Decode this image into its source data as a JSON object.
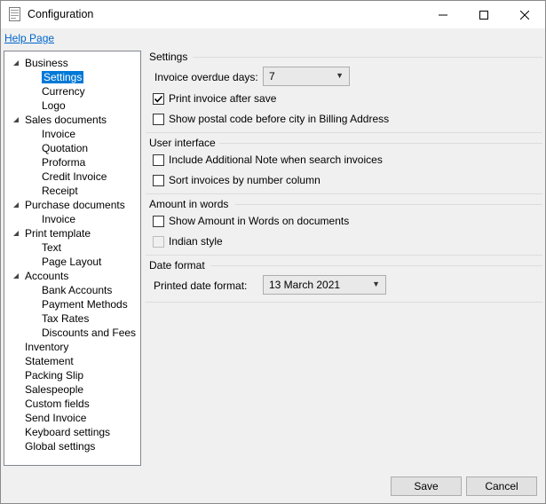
{
  "window": {
    "title": "Configuration"
  },
  "help_link": "Help Page",
  "tree": [
    {
      "label": "Business",
      "level": 0,
      "expanded": true
    },
    {
      "label": "Settings",
      "level": 1,
      "selected": true
    },
    {
      "label": "Currency",
      "level": 1
    },
    {
      "label": "Logo",
      "level": 1
    },
    {
      "label": "Sales documents",
      "level": 0,
      "expanded": true
    },
    {
      "label": "Invoice",
      "level": 1
    },
    {
      "label": "Quotation",
      "level": 1
    },
    {
      "label": "Proforma",
      "level": 1
    },
    {
      "label": "Credit Invoice",
      "level": 1
    },
    {
      "label": "Receipt",
      "level": 1
    },
    {
      "label": "Purchase documents",
      "level": 0,
      "expanded": true
    },
    {
      "label": "Invoice",
      "level": 1
    },
    {
      "label": "Print template",
      "level": 0,
      "expanded": true
    },
    {
      "label": "Text",
      "level": 1
    },
    {
      "label": "Page Layout",
      "level": 1
    },
    {
      "label": "Accounts",
      "level": 0,
      "expanded": true
    },
    {
      "label": "Bank Accounts",
      "level": 1
    },
    {
      "label": "Payment Methods",
      "level": 1
    },
    {
      "label": "Tax Rates",
      "level": 1
    },
    {
      "label": "Discounts and Fees",
      "level": 1
    },
    {
      "label": "Inventory",
      "level": 0
    },
    {
      "label": "Statement",
      "level": 0
    },
    {
      "label": "Packing Slip",
      "level": 0
    },
    {
      "label": "Salespeople",
      "level": 0
    },
    {
      "label": "Custom fields",
      "level": 0
    },
    {
      "label": "Send Invoice",
      "level": 0
    },
    {
      "label": "Keyboard settings",
      "level": 0
    },
    {
      "label": "Global settings",
      "level": 0
    }
  ],
  "settings": {
    "title": "Settings",
    "overdue_label": "Invoice overdue days:",
    "overdue_value": "7",
    "print_after_save": {
      "label": "Print invoice after save",
      "checked": true
    },
    "postal_before_city": {
      "label": "Show postal code before city in Billing Address",
      "checked": false
    }
  },
  "ui": {
    "title": "User interface",
    "additional_note": {
      "label": "Include Additional Note when search invoices",
      "checked": false
    },
    "sort_by_number": {
      "label": "Sort invoices by number column",
      "checked": false
    }
  },
  "words": {
    "title": "Amount in words",
    "show_words": {
      "label": "Show Amount in Words on documents",
      "checked": false
    },
    "indian_style": {
      "label": "Indian style",
      "checked": false,
      "disabled": true
    }
  },
  "date": {
    "title": "Date format",
    "printed_label": "Printed date format:",
    "printed_value": "13 March 2021"
  },
  "buttons": {
    "save": "Save",
    "cancel": "Cancel"
  }
}
